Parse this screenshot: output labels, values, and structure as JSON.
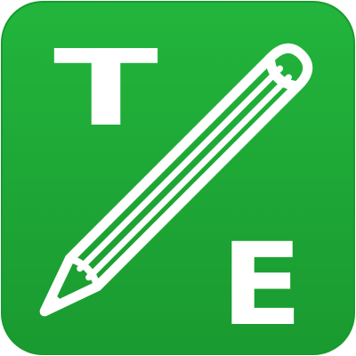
{
  "icon": {
    "name": "pencil-icon",
    "letters": {
      "top_left": "T",
      "bottom_right": "E"
    },
    "colors": {
      "background": "#22b53c",
      "background_shadow": "#1a9a30",
      "foreground": "#ffffff"
    }
  }
}
